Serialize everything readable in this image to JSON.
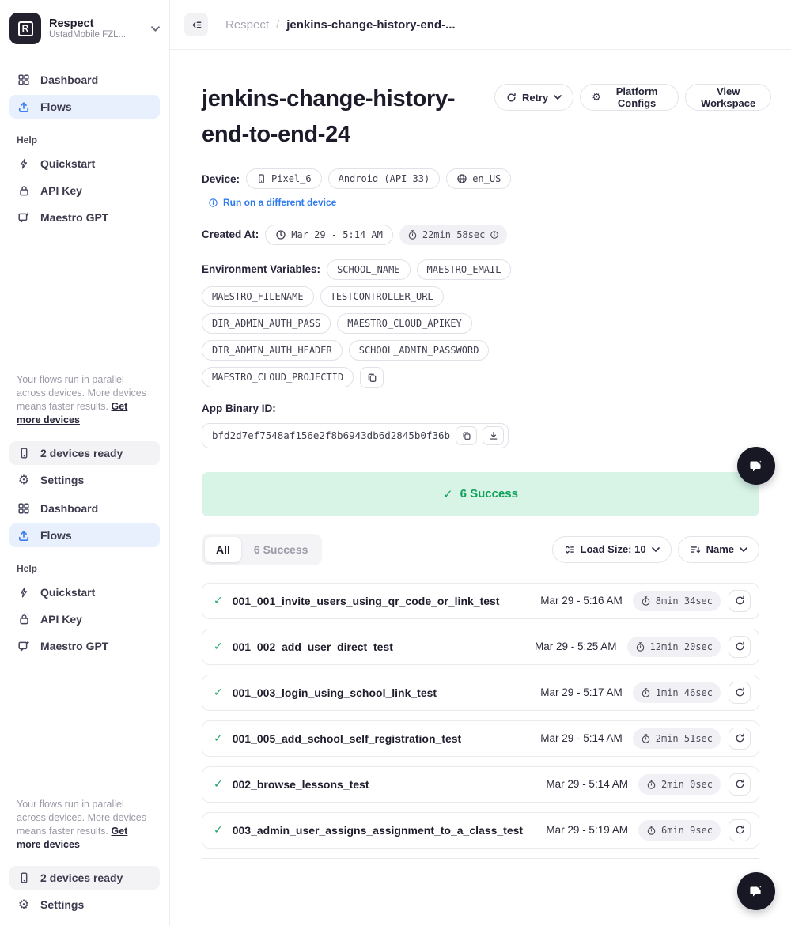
{
  "workspace": {
    "logo_letter": "R",
    "name": "Respect",
    "org": "UstadMobile FZL..."
  },
  "sidebar": {
    "dashboard": "Dashboard",
    "flows": "Flows",
    "help": "Help",
    "quickstart": "Quickstart",
    "api_key": "API Key",
    "maestro_gpt": "Maestro GPT",
    "note_text": "Your flows run in parallel across devices. More devices means faster results. ",
    "note_link": "Get more devices",
    "devices_ready": "2 devices ready",
    "settings": "Settings"
  },
  "header": {
    "breadcrumb_root": "Respect",
    "breadcrumb_sep": "/",
    "breadcrumb_current": "jenkins-change-history-end-..."
  },
  "main": {
    "title": "jenkins-change-history-end-to-end-24",
    "actions": {
      "retry": "Retry",
      "platform_configs": "Platform Configs",
      "view_workspace": "View Workspace"
    },
    "device": {
      "label": "Device:",
      "model": "Pixel_6",
      "os": "Android (API 33)",
      "locale": "en_US"
    },
    "run_link": "Run on a different device",
    "created": {
      "label": "Created At:",
      "time": "Mar 29 - 5:14 AM",
      "duration": "22min 58sec"
    },
    "env": {
      "label": "Environment Variables:",
      "vars": [
        "SCHOOL_NAME",
        "MAESTRO_EMAIL",
        "MAESTRO_FILENAME",
        "TESTCONTROLLER_URL",
        "DIR_ADMIN_AUTH_PASS",
        "MAESTRO_CLOUD_APIKEY",
        "DIR_ADMIN_AUTH_HEADER",
        "SCHOOL_ADMIN_PASSWORD",
        "MAESTRO_CLOUD_PROJECTID"
      ]
    },
    "binary": {
      "label": "App Binary ID:",
      "id": "bfd2d7ef7548af156e2f8b6943db6d2845b0f36b"
    },
    "banner": {
      "text": "6 Success"
    },
    "tabs": {
      "all": "All",
      "success": "6 Success"
    },
    "toolbar": {
      "load_size": "Load Size: 10",
      "sort": "Name"
    },
    "tests": [
      {
        "name": "001_001_invite_users_using_qr_code_or_link_test",
        "date": "Mar 29 - 5:16 AM",
        "duration": "8min 34sec"
      },
      {
        "name": "001_002_add_user_direct_test",
        "date": "Mar 29 - 5:25 AM",
        "duration": "12min 20sec"
      },
      {
        "name": "001_003_login_using_school_link_test",
        "date": "Mar 29 - 5:17 AM",
        "duration": "1min 46sec"
      },
      {
        "name": "001_005_add_school_self_registration_test",
        "date": "Mar 29 - 5:14 AM",
        "duration": "2min 51sec"
      },
      {
        "name": "002_browse_lessons_test",
        "date": "Mar 29 - 5:14 AM",
        "duration": "2min 0sec"
      },
      {
        "name": "003_admin_user_assigns_assignment_to_a_class_test",
        "date": "Mar 29 - 5:19 AM",
        "duration": "6min 9sec"
      }
    ]
  },
  "icons": {
    "check": "✓",
    "gear": "⚙"
  },
  "colors": {
    "accent_blue": "#3e7df2",
    "link_blue": "#2e7bf0",
    "success_green": "#0fa05a",
    "success_bg": "#d8f4e6",
    "active_nav_bg": "#e7f0fc",
    "chip_bg": "#f1f1f5",
    "fab_bg": "#181724"
  }
}
